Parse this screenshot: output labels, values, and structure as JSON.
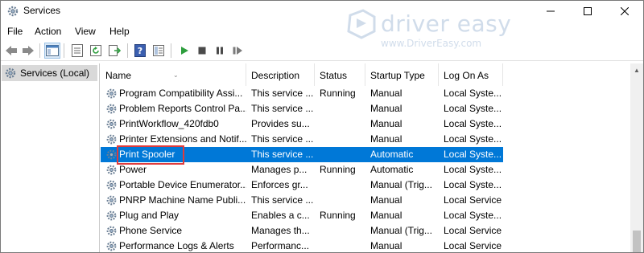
{
  "window": {
    "title": "Services",
    "icon": "gear-icon",
    "controls": [
      "minimize-icon",
      "maximize-icon",
      "close-icon"
    ]
  },
  "watermark": {
    "brand": "driver easy",
    "url": "www.DriverEasy.com"
  },
  "menu": [
    {
      "label": "File"
    },
    {
      "label": "Action"
    },
    {
      "label": "View"
    },
    {
      "label": "Help"
    }
  ],
  "toolbar": {
    "buttons": [
      "back-arrow-icon",
      "forward-arrow-icon",
      "show-hide-console-tree-icon",
      "properties-icon",
      "refresh-icon",
      "export-list-icon",
      "help-icon",
      "mmc-view-icon",
      "start-service-icon",
      "stop-service-icon",
      "pause-service-icon",
      "resume-service-icon"
    ]
  },
  "tree": {
    "label": "Services (Local)",
    "icon": "gear-icon",
    "selected": true
  },
  "table": {
    "columns": [
      "Name",
      "Description",
      "Status",
      "Startup Type",
      "Log On As"
    ],
    "sort_column": "Name",
    "rows": [
      {
        "name": "Program Compatibility Assi...",
        "description": "This service ...",
        "status": "Running",
        "startup": "Manual",
        "logon": "Local Syste..."
      },
      {
        "name": "Problem Reports Control Pa...",
        "description": "This service ...",
        "status": "",
        "startup": "Manual",
        "logon": "Local Syste..."
      },
      {
        "name": "PrintWorkflow_420fdb0",
        "description": "Provides su...",
        "status": "",
        "startup": "Manual",
        "logon": "Local Syste..."
      },
      {
        "name": "Printer Extensions and Notif...",
        "description": "This service ...",
        "status": "",
        "startup": "Manual",
        "logon": "Local Syste..."
      },
      {
        "name": "Print Spooler",
        "description": "This service ...",
        "status": "",
        "startup": "Automatic",
        "logon": "Local Syste...",
        "selected": true,
        "highlighted": true
      },
      {
        "name": "Power",
        "description": "Manages p...",
        "status": "Running",
        "startup": "Automatic",
        "logon": "Local Syste..."
      },
      {
        "name": "Portable Device Enumerator...",
        "description": "Enforces gr...",
        "status": "",
        "startup": "Manual (Trig...",
        "logon": "Local Syste..."
      },
      {
        "name": "PNRP Machine Name Publi...",
        "description": "This service ...",
        "status": "",
        "startup": "Manual",
        "logon": "Local Service"
      },
      {
        "name": "Plug and Play",
        "description": "Enables a c...",
        "status": "Running",
        "startup": "Manual",
        "logon": "Local Syste..."
      },
      {
        "name": "Phone Service",
        "description": "Manages th...",
        "status": "",
        "startup": "Manual (Trig...",
        "logon": "Local Service"
      },
      {
        "name": "Performance Logs & Alerts",
        "description": "Performanc...",
        "status": "",
        "startup": "Manual",
        "logon": "Local Service"
      }
    ]
  },
  "colors": {
    "selection": "#0078d7",
    "highlight_box": "#e03b3b",
    "play_green": "#2e9e3e"
  }
}
